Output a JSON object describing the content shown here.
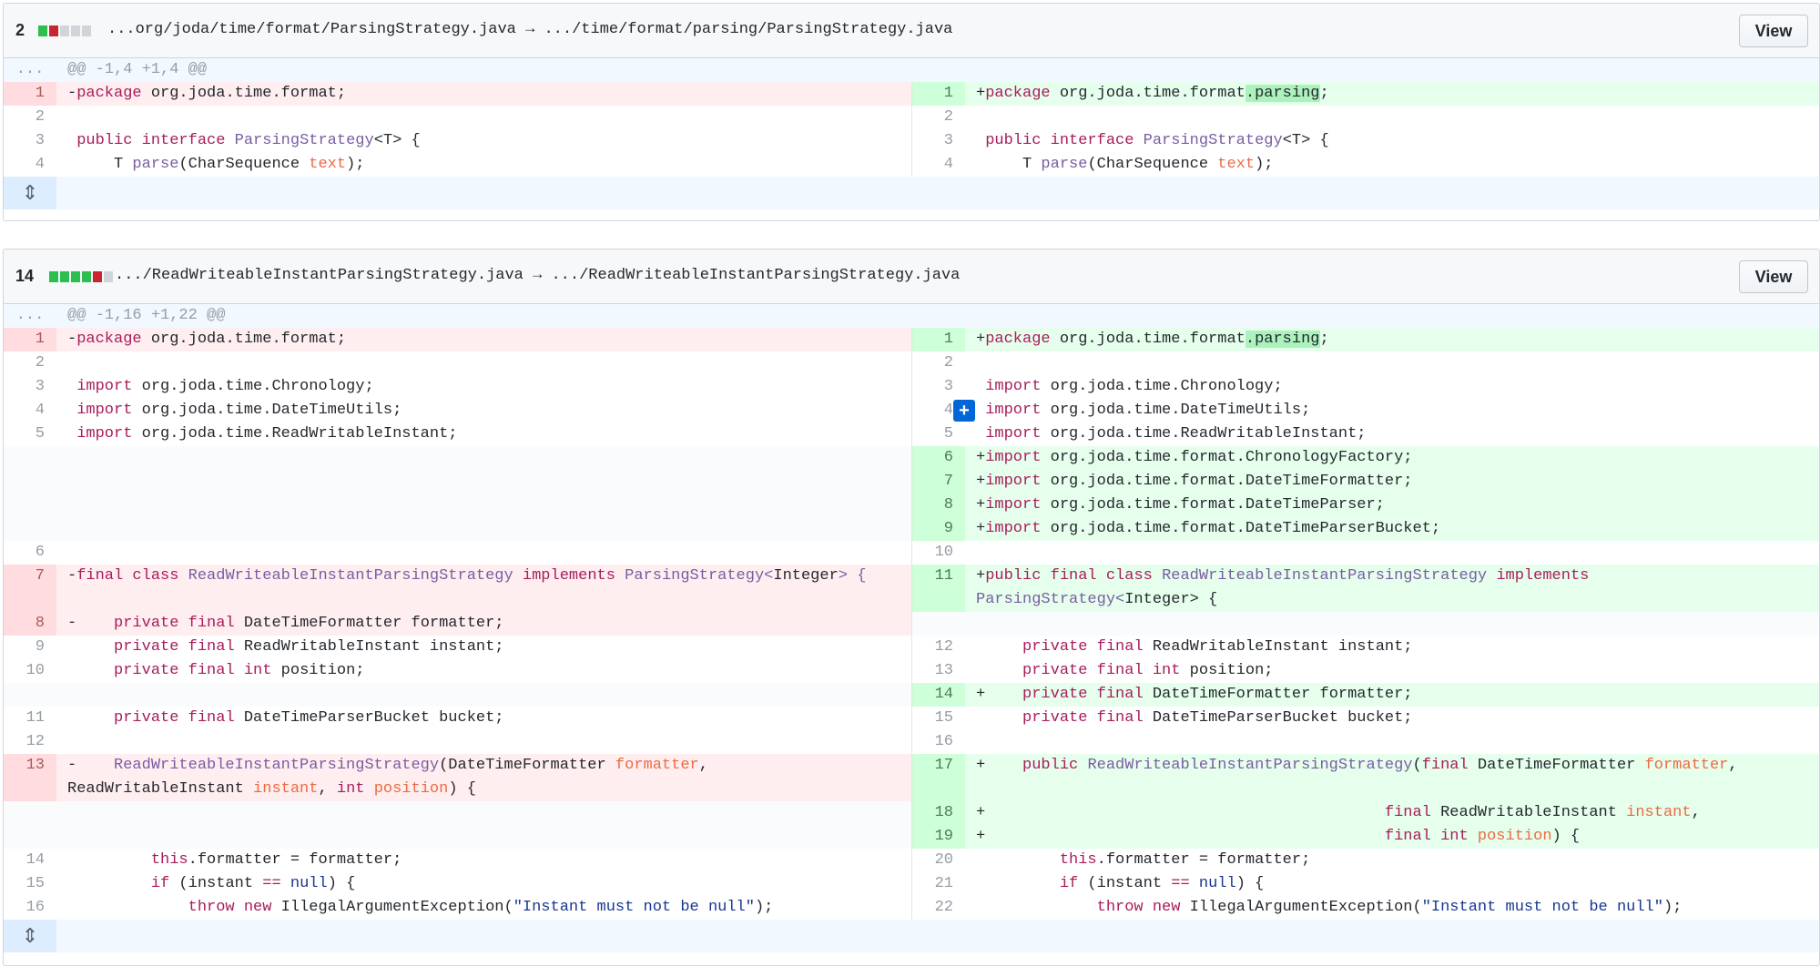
{
  "files": [
    {
      "count": "2",
      "diffstat": [
        "add",
        "del",
        "neu",
        "neu",
        "neu"
      ],
      "path": "...org/joda/time/format/ParsingStrategy.java → .../time/format/parsing/ParsingStrategy.java",
      "view_label": "View",
      "hunk_num": "...",
      "hunk": "@@ -1,4 +1,4 @@",
      "expander_icon": "unfold-icon"
    },
    {
      "count": "14",
      "diffstat": [
        "add",
        "add",
        "add",
        "add",
        "del",
        "neu"
      ],
      "path": ".../ReadWriteableInstantParsingStrategy.java → .../ReadWriteableInstantParsingStrategy.java",
      "view_label": "View",
      "hunk_num": "...",
      "hunk": "@@ -1,16 +1,22 @@",
      "expander_icon": "unfold-icon"
    }
  ],
  "lines": {
    "f1": [
      {
        "l": "1",
        "r": "1"
      },
      {
        "l": "2",
        "r": "2"
      },
      {
        "l": "3",
        "r": "3"
      },
      {
        "l": "4",
        "r": "4"
      }
    ],
    "f2": [
      {
        "l": "1",
        "r": "1"
      },
      {
        "l": "2",
        "r": "2"
      },
      {
        "l": "3",
        "r": "3"
      },
      {
        "l": "4",
        "r": "4"
      },
      {
        "l": "5",
        "r": "5"
      },
      {
        "l": "",
        "r": "6"
      },
      {
        "l": "",
        "r": "7"
      },
      {
        "l": "",
        "r": "8"
      },
      {
        "l": "",
        "r": "9"
      },
      {
        "l": "6",
        "r": "10"
      },
      {
        "l": "7",
        "r": "11"
      },
      {
        "l": "8",
        "r": ""
      },
      {
        "l": "9",
        "r": "12"
      },
      {
        "l": "10",
        "r": "13"
      },
      {
        "l": "",
        "r": "14"
      },
      {
        "l": "11",
        "r": "15"
      },
      {
        "l": "12",
        "r": "16"
      },
      {
        "l": "13",
        "r": "17"
      },
      {
        "l": "",
        "r": "18"
      },
      {
        "l": "",
        "r": "19"
      },
      {
        "l": "14",
        "r": "20"
      },
      {
        "l": "15",
        "r": "21"
      },
      {
        "l": "16",
        "r": "22"
      }
    ]
  },
  "tokens": {
    "minus": "-",
    "plus": "+",
    "space": " ",
    "package": "package",
    "pkg_format": " org.joda.time.format",
    "dot": ".",
    "parsing": "parsing",
    "semi": ";",
    "public": "public",
    "interface": "interface",
    "ParsingStrategy": "ParsingStrategy",
    "generic_T_open": "<T> {",
    "T_parse_pre": "    T ",
    "parse": "parse",
    "charseq": "(CharSequence ",
    "text": "text",
    "close_semi": ");",
    "import": "import",
    "imp_chrono": " org.joda.time.Chronology;",
    "imp_dtu": " org.joda.time.DateTimeUtils;",
    "imp_rwi": " org.joda.time.ReadWritableInstant;",
    "imp_cf": " org.joda.time.format.ChronologyFactory;",
    "imp_dtf": " org.joda.time.format.DateTimeFormatter;",
    "imp_dtp": " org.joda.time.format.DateTimeParser;",
    "imp_dtpb": " org.joda.time.format.DateTimeParserBucket;",
    "final": "final",
    "class": "class",
    "RWIPS": "ReadWriteableInstantParsingStrategy",
    "implements": "implements",
    "ParsingStrategyLt": "ParsingStrategy<",
    "Integer": "Integer",
    "gt_brace": "> {",
    "private": "private",
    "int": "int",
    "f_dtf": " DateTimeFormatter formatter;",
    "f_rwi": " ReadWritableInstant instant;",
    "f_pos": " position;",
    "f_bucket": " DateTimeParserBucket bucket;",
    "ctor_open_l": "(DateTimeFormatter ",
    "ctor_final_open": "(",
    "formatter": "formatter",
    "comma": ",",
    "rwi_type": "ReadWritableInstant ",
    "instant": "instant",
    "position": "position",
    "paren_brace": ") {",
    "dtf_type": " DateTimeFormatter ",
    "this": "this",
    "this_rest": ".formatter = formatter;",
    "if": "if",
    "if_rest": " (instant ",
    "eqeq": "==",
    "null": "null",
    "paren_brace2": ") {",
    "throw": "throw",
    "new": "new",
    "iae": " IllegalArgumentException(",
    "msg": "\"Instant must not be null\""
  },
  "plus_button_label": "+"
}
